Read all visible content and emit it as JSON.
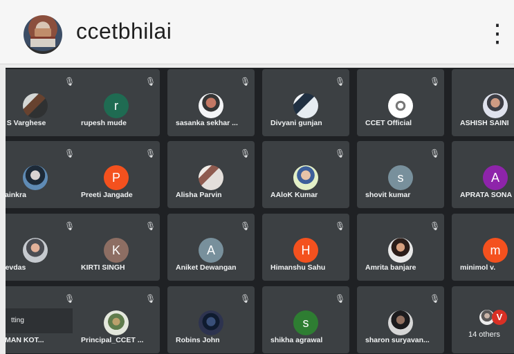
{
  "app": {
    "title": "ccetbhilai",
    "more_icon": "vertical-dots-icon"
  },
  "tiles": [
    {
      "name": "P S Varghese",
      "avatar_type": "photo",
      "initial": ""
    },
    {
      "name": "rupesh mude",
      "avatar_type": "initial",
      "initial": "r",
      "color": "#1f6b52"
    },
    {
      "name": "sasanka sekhar ...",
      "avatar_type": "photo",
      "initial": ""
    },
    {
      "name": "Divyani gunjan",
      "avatar_type": "photo",
      "initial": ""
    },
    {
      "name": "CCET Official",
      "avatar_type": "photo",
      "initial": ""
    },
    {
      "name": "ASHISH SAINI",
      "avatar_type": "photo",
      "initial": ""
    },
    {
      "name": "Painkra",
      "avatar_type": "photo",
      "initial": ""
    },
    {
      "name": "Preeti Jangade",
      "avatar_type": "initial",
      "initial": "P",
      "color": "#f4511e"
    },
    {
      "name": "Alisha Parvin",
      "avatar_type": "photo",
      "initial": ""
    },
    {
      "name": "AAloK Kumar",
      "avatar_type": "photo",
      "initial": ""
    },
    {
      "name": "shovit kumar",
      "avatar_type": "initial",
      "initial": "s",
      "color": "#78909c"
    },
    {
      "name": "APRATA SONA",
      "avatar_type": "initial",
      "initial": "A",
      "color": "#8e24aa"
    },
    {
      "name": "Devdas",
      "avatar_type": "photo",
      "initial": ""
    },
    {
      "name": "KIRTI SINGH",
      "avatar_type": "initial",
      "initial": "K",
      "color": "#8d6e63"
    },
    {
      "name": "Aniket Dewangan",
      "avatar_type": "initial",
      "initial": "A",
      "color": "#78909c"
    },
    {
      "name": "Himanshu Sahu",
      "avatar_type": "initial",
      "initial": "H",
      "color": "#f4511e"
    },
    {
      "name": "Amrita banjare",
      "avatar_type": "photo",
      "initial": ""
    },
    {
      "name": "minimol v.",
      "avatar_type": "initial",
      "initial": "m",
      "color": "#f4511e"
    },
    {
      "name": "EMAN KOT...",
      "avatar_type": "none",
      "initial": ""
    },
    {
      "name": "Principal_CCET ...",
      "avatar_type": "photo",
      "initial": ""
    },
    {
      "name": "Robins John",
      "avatar_type": "photo",
      "initial": ""
    },
    {
      "name": "shikha agrawal",
      "avatar_type": "initial",
      "initial": "s",
      "color": "#2e7d32"
    },
    {
      "name": "sharon suryavan...",
      "avatar_type": "photo",
      "initial": ""
    },
    {
      "name": "",
      "avatar_type": "others",
      "initial": "V",
      "others": "14 others"
    }
  ],
  "chip_label": "tting",
  "icons": {
    "mic": "microphone-off-icon",
    "avatar": "participant-avatar-icon"
  }
}
